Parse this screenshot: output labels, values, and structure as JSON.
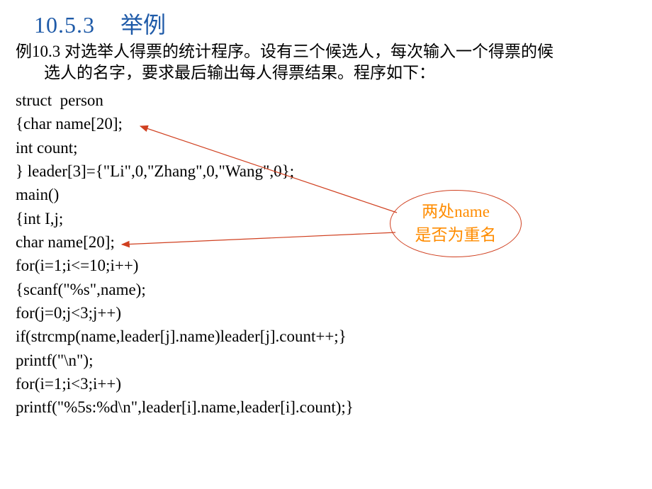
{
  "heading": {
    "number": "10.5.3",
    "title": "举例"
  },
  "description": {
    "line1": "例10.3  对选举人得票的统计程序。设有三个候选人，每次输入一个得票的候",
    "line2": "选人的名字，要求最后输出每人得票结果。程序如下："
  },
  "code": {
    "l1": "struct  person",
    "l2": "{char name[20];",
    "l3": "int count;",
    "l4": "} leader[3]={\"Li\",0,\"Zhang\",0,\"Wang\",0};",
    "l5": "main()",
    "l6": "{int I,j;",
    "l7": "char name[20];",
    "l8": "for(i=1;i<=10;i++)",
    "l9": "{scanf(\"%s\",name);",
    "l10": "for(j=0;j<3;j++)",
    "l11": "if(strcmp(name,leader[j].name)leader[j].count++;}",
    "l12": "printf(\"\\n\");",
    "l13": "for(i=1;i<3;i++)",
    "l14": "printf(\"%5s:%d\\n\",leader[i].name,leader[i].count);}"
  },
  "annotation": {
    "line1": "两处name",
    "line2": "是否为重名"
  }
}
